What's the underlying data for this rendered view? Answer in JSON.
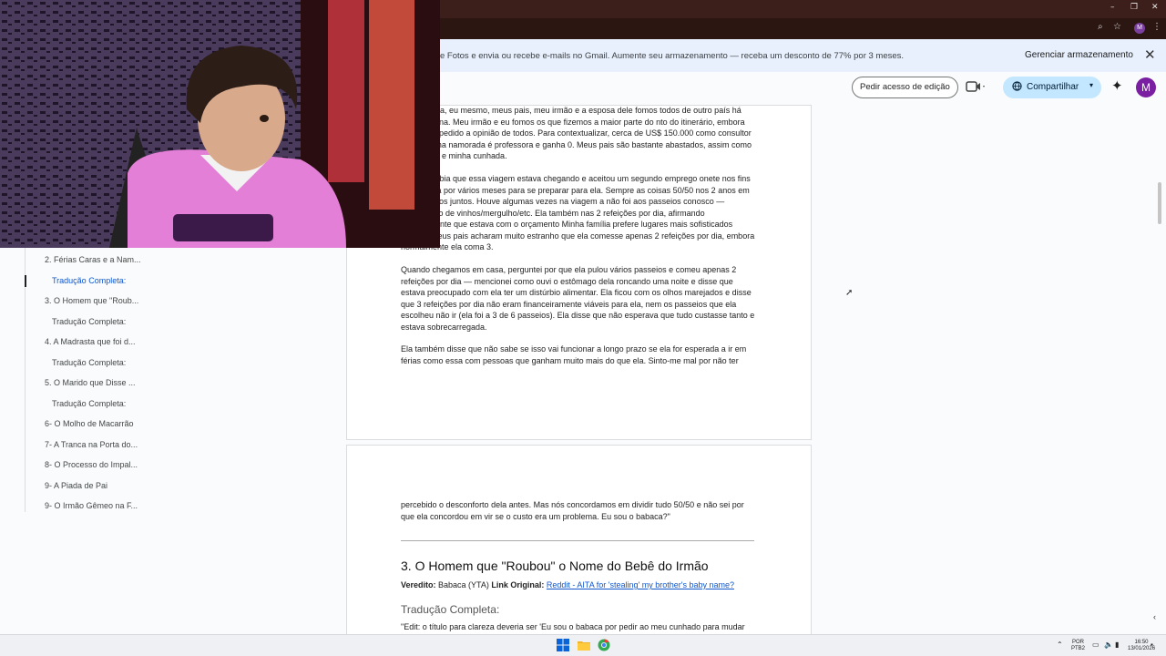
{
  "window": {
    "minimize": "–",
    "restore": "❐",
    "close": "✕"
  },
  "browser": {
    "zoom_icon": "search-zoom-icon",
    "star_icon": "bookmark-star-icon",
    "profile_letter": "M",
    "menu": "⋮"
  },
  "banner": {
    "message": "e Fotos e envia ou recebe e-mails no Gmail. Aumente seu armazenamento — receba um desconto de 77% por 3 meses.",
    "manage_label": "Gerenciar armazenamento",
    "close": "✕"
  },
  "toolbar": {
    "request_edit": "Pedir acesso de edição",
    "share_label": "Compartilhar",
    "avatar_letter": "M"
  },
  "outline": [
    {
      "label": "2. Férias Caras e a Nam...",
      "active": false
    },
    {
      "label": "Tradução Completa:",
      "active": true
    },
    {
      "label": "3. O Homem que \"Roub...",
      "active": false
    },
    {
      "label": "Tradução Completa:",
      "active": false
    },
    {
      "label": "4. A Madrasta que foi d...",
      "active": false
    },
    {
      "label": "Tradução Completa:",
      "active": false
    },
    {
      "label": "5. O Marido que Disse ...",
      "active": false
    },
    {
      "label": "Tradução Completa:",
      "active": false
    },
    {
      "label": "6- O Molho de Macarrão",
      "active": false
    },
    {
      "label": "7- A Tranca na Porta do...",
      "active": false
    },
    {
      "label": "8- O Processo do Impal...",
      "active": false
    },
    {
      "label": "9- A Piada de Pai",
      "active": false
    },
    {
      "label": "9- O Irmão Gêmeo na F...",
      "active": false
    }
  ],
  "doc": {
    "p1": "a namorada, eu mesmo, meus pais, meu irmão e a esposa dele fomos todos de outro país há uma semana. Meu irmão e eu fomos os que fizemos a maior parte do nto do itinerário, embora tenhamos pedido a opinião de todos. Para contextualizar, cerca de US$ 150.000 como consultor de TI, minha namorada é professora e ganha 0. Meus pais são bastante abastados, assim como meu irmão e minha cunhada.",
    "p2": "morada sabia que essa viagem estava chegando e aceitou um segundo emprego onete nos fins de semana por vários meses para se preparar para ela. Sempre as coisas 50/50 nos 2 anos em que estamos juntos. Houve algumas vezes na viagem a não foi aos passeios conosco — degustação de vinhos/mergulho/etc. Ela também nas 2 refeições por dia, afirmando simplesmente que estava com o orçamento Minha família prefere lugares mais sofisticados (caros). Meus pais acharam muito estranho que ela comesse apenas 2 refeições por dia, embora normalmente ela coma 3.",
    "p3": "Quando chegamos em casa, perguntei por que ela pulou vários passeios e comeu apenas 2 refeições por dia — mencionei como ouvi o estômago dela roncando uma noite e disse que estava preocupado com ela ter um distúrbio alimentar. Ela ficou com os olhos marejados e disse que 3 refeições por dia não eram financeiramente viáveis para ela, nem os passeios que ela escolheu não ir (ela foi a 3 de 6 passeios). Ela disse que não esperava que tudo custasse tanto e estava sobrecarregada.",
    "p4": "Ela também disse que não sabe se isso vai funcionar a longo prazo se ela for esperada a ir em férias como essa com pessoas que ganham muito mais do que ela. Sinto-me mal por não ter",
    "p5": "percebido o desconforto dela antes. Mas nós concordamos em dividir tudo 50/50 e não sei por que ela concordou em vir se o custo era um problema. Eu sou o babaca?\"",
    "h2": "3. O Homem que \"Roubou\" o Nome do Bebê do Irmão",
    "verdict_label": "Veredito:",
    "verdict_value": " Babaca (YTA) ",
    "link_label": "Link Original:",
    "link_text": "Reddit - AITA for 'stealing' my brother's baby name?",
    "h3": "Tradução Completa:",
    "p6": "\"Edit: o título para clareza deveria ser 'Eu sou o babaca por pedir ao meu cunhado para mudar"
  },
  "taskbar": {
    "lang_top": "POR",
    "lang_bottom": "PTB2",
    "time": "16:50",
    "date": "13/01/2026"
  },
  "colors": {
    "accent": "#0b57d0",
    "share_bg": "#c2e7ff",
    "banner_bg": "#e8f0fe",
    "titlebar": "#3c1f1a"
  }
}
